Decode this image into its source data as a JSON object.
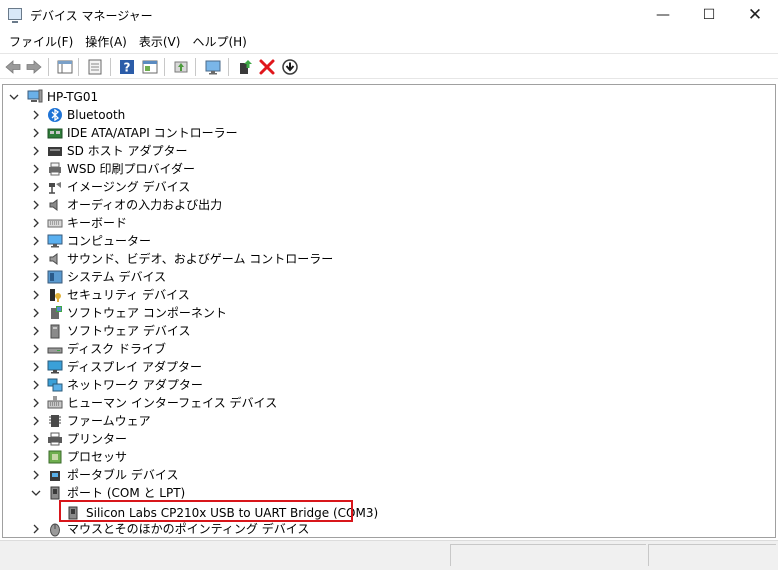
{
  "window": {
    "title": "デバイス マネージャー",
    "controls": {
      "minimize": "—",
      "maximize": "☐",
      "close": "✕"
    }
  },
  "menu": [
    "ファイル(F)",
    "操作(A)",
    "表示(V)",
    "ヘルプ(H)"
  ],
  "toolbar": [
    "back-icon",
    "forward-icon",
    "properties-grid-icon",
    "document-icon",
    "help-icon",
    "view-icon",
    "scan-icon",
    "monitor-icon",
    "update-driver-icon",
    "uninstall-icon",
    "download-icon"
  ],
  "tree": {
    "root": "HP-TG01",
    "categories": [
      {
        "label": "Bluetooth",
        "icon": "bluetooth-icon",
        "expanded": false
      },
      {
        "label": "IDE ATA/ATAPI コントローラー",
        "icon": "ide-controller-icon",
        "expanded": false
      },
      {
        "label": "SD ホスト アダプター",
        "icon": "sd-host-icon",
        "expanded": false
      },
      {
        "label": "WSD 印刷プロバイダー",
        "icon": "printer-provider-icon",
        "expanded": false
      },
      {
        "label": "イメージング デバイス",
        "icon": "camera-icon",
        "expanded": false
      },
      {
        "label": "オーディオの入力および出力",
        "icon": "speaker-icon",
        "expanded": false
      },
      {
        "label": "キーボード",
        "icon": "keyboard-icon",
        "expanded": false
      },
      {
        "label": "コンピューター",
        "icon": "computer-icon",
        "expanded": false
      },
      {
        "label": "サウンド、ビデオ、およびゲーム コントローラー",
        "icon": "sound-icon",
        "expanded": false
      },
      {
        "label": "システム デバイス",
        "icon": "system-device-icon",
        "expanded": false
      },
      {
        "label": "セキュリティ デバイス",
        "icon": "security-key-icon",
        "expanded": false
      },
      {
        "label": "ソフトウェア コンポーネント",
        "icon": "software-component-icon",
        "expanded": false
      },
      {
        "label": "ソフトウェア デバイス",
        "icon": "software-device-icon",
        "expanded": false
      },
      {
        "label": "ディスク ドライブ",
        "icon": "disk-drive-icon",
        "expanded": false
      },
      {
        "label": "ディスプレイ アダプター",
        "icon": "display-adapter-icon",
        "expanded": false
      },
      {
        "label": "ネットワーク アダプター",
        "icon": "network-adapter-icon",
        "expanded": false
      },
      {
        "label": "ヒューマン インターフェイス デバイス",
        "icon": "hid-icon",
        "expanded": false
      },
      {
        "label": "ファームウェア",
        "icon": "firmware-icon",
        "expanded": false
      },
      {
        "label": "プリンター",
        "icon": "printer-icon",
        "expanded": false
      },
      {
        "label": "プロセッサ",
        "icon": "processor-icon",
        "expanded": false
      },
      {
        "label": "ポータブル デバイス",
        "icon": "portable-device-icon",
        "expanded": false
      },
      {
        "label": "ポート (COM と LPT)",
        "icon": "port-icon",
        "expanded": true,
        "children": [
          {
            "label": "Silicon Labs CP210x USB to UART Bridge (COM3)",
            "icon": "usb-serial-icon",
            "highlighted": true
          }
        ]
      },
      {
        "label": "マウスとそのほかのポインティング デバイス",
        "icon": "mouse-icon",
        "expanded": false
      }
    ]
  },
  "colors": {
    "highlight_border": "#d8161b",
    "uninstall_red": "#e0161b",
    "help_blue": "#2b5ca8"
  }
}
